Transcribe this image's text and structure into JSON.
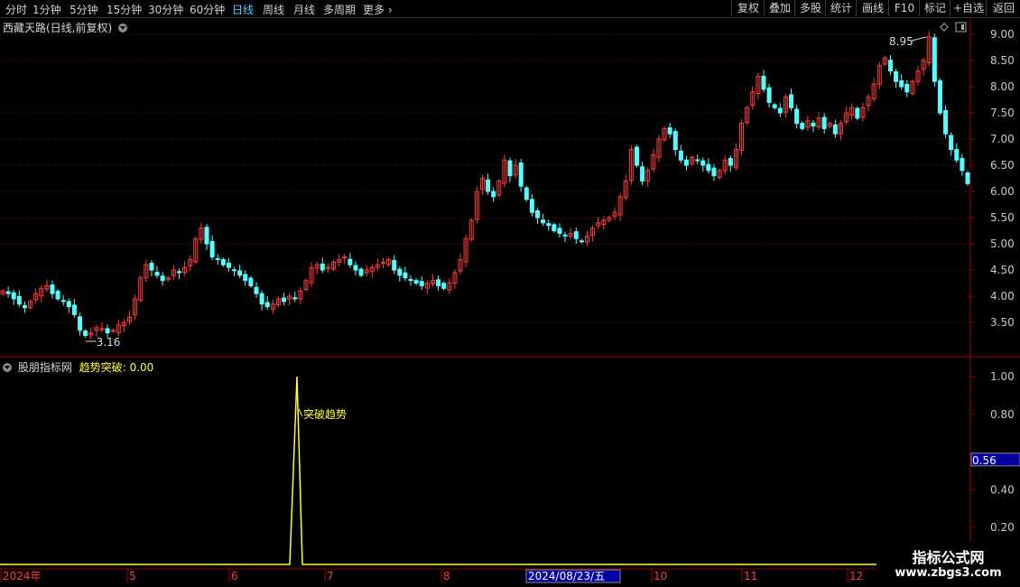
{
  "toolbar": {
    "periods": [
      "分时",
      "1分钟",
      "5分钟",
      "15分钟",
      "30分钟",
      "60分钟",
      "日线",
      "周线",
      "月线",
      "多周期",
      "更多"
    ],
    "active_period": "日线",
    "more_arrow": "›",
    "right_buttons": [
      "复权",
      "叠加",
      "多股",
      "统计",
      "画线",
      "F10",
      "标记",
      "+自选",
      "返回"
    ]
  },
  "main_panel": {
    "title": "西藏天路(日线,前复权)",
    "high_label": "8.95",
    "low_label": "3.16",
    "price_ticks": [
      "9.00",
      "8.50",
      "8.00",
      "7.50",
      "7.00",
      "6.50",
      "6.00",
      "5.50",
      "5.00",
      "4.50",
      "4.00",
      "3.50"
    ],
    "diamond_icon": "diamond-icon",
    "toggle_icon": "panel-toggle-icon"
  },
  "indicator_panel": {
    "source": "股朋指标网",
    "indicator_name": "趋势突破",
    "indicator_value": "0.00",
    "signal_label": "突破趋势",
    "ticks": [
      "1.00",
      "0.80",
      "0.40",
      "0.20"
    ],
    "current_value_badge": "0.56"
  },
  "time_axis": {
    "labels": [
      "2024年",
      "5",
      "6",
      "7",
      "8",
      "10",
      "11",
      "12"
    ],
    "cursor_date": "2024/08/23/五"
  },
  "watermark": {
    "line1": "指标公式网",
    "line2": "www.zbgs3.com"
  },
  "colors": {
    "up": "#ff3c3c",
    "down": "#54ffff",
    "grid": "#8b0000",
    "indicator": "#ffff3c",
    "axis": "#a00000"
  },
  "chart_data": {
    "type": "candlestick",
    "symbol": "西藏天路",
    "period": "日线",
    "adjust": "前复权",
    "y_range": [
      3.05,
      9.15
    ],
    "close_series": [
      4.1,
      4.05,
      3.95,
      3.85,
      3.78,
      3.9,
      4.05,
      4.15,
      4.2,
      4.05,
      3.95,
      3.9,
      3.8,
      3.65,
      3.35,
      3.25,
      3.3,
      3.4,
      3.38,
      3.3,
      3.35,
      3.45,
      3.5,
      3.6,
      3.95,
      4.35,
      4.6,
      4.5,
      4.4,
      4.3,
      4.35,
      4.5,
      4.45,
      4.55,
      4.7,
      5.1,
      5.3,
      5.0,
      4.75,
      4.7,
      4.6,
      4.55,
      4.5,
      4.4,
      4.3,
      4.2,
      4.05,
      3.85,
      3.8,
      3.85,
      3.95,
      3.9,
      4.0,
      3.95,
      4.1,
      4.3,
      4.55,
      4.6,
      4.5,
      4.55,
      4.65,
      4.7,
      4.75,
      4.6,
      4.5,
      4.4,
      4.5,
      4.55,
      4.6,
      4.65,
      4.7,
      4.5,
      4.4,
      4.35,
      4.3,
      4.25,
      4.2,
      4.25,
      4.3,
      4.2,
      4.15,
      4.25,
      4.45,
      4.7,
      5.1,
      5.45,
      6.0,
      6.25,
      6.0,
      5.9,
      6.2,
      6.6,
      6.3,
      6.5,
      6.1,
      5.85,
      5.6,
      5.5,
      5.4,
      5.35,
      5.25,
      5.2,
      5.15,
      5.2,
      5.1,
      5.05,
      5.15,
      5.3,
      5.4,
      5.45,
      5.5,
      5.6,
      5.9,
      6.2,
      6.8,
      6.5,
      6.2,
      6.4,
      6.7,
      7.0,
      7.2,
      7.1,
      6.8,
      6.6,
      6.5,
      6.65,
      6.6,
      6.5,
      6.4,
      6.3,
      6.4,
      6.6,
      6.5,
      6.8,
      7.3,
      7.6,
      7.9,
      8.2,
      7.95,
      7.7,
      7.6,
      7.5,
      7.8,
      7.6,
      7.3,
      7.2,
      7.35,
      7.25,
      7.4,
      7.2,
      7.3,
      7.1,
      7.3,
      7.5,
      7.6,
      7.4,
      7.6,
      7.8,
      8.05,
      8.4,
      8.55,
      8.3,
      8.1,
      8.0,
      7.9,
      8.1,
      8.3,
      8.5,
      8.95,
      8.1,
      7.5,
      7.1,
      6.8,
      6.6,
      6.4,
      6.15
    ],
    "max_label": {
      "value": "8.95"
    },
    "min_label": {
      "value": "3.16"
    }
  }
}
